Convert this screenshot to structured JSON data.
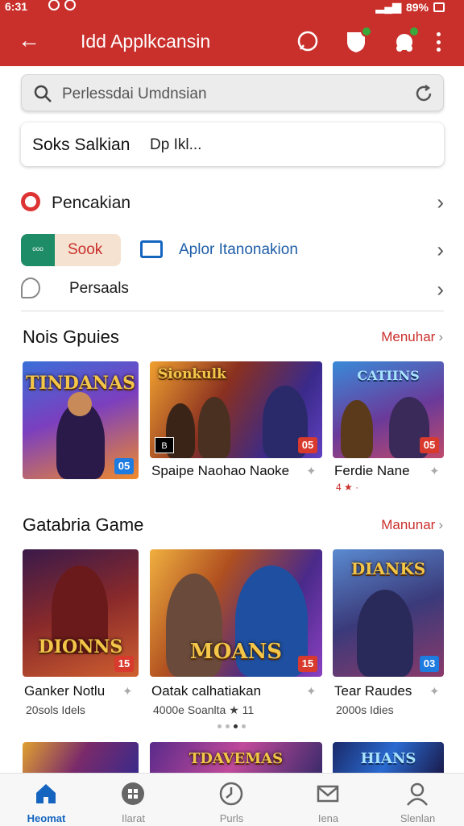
{
  "status_bar": {
    "time": "6:31",
    "battery": "89%"
  },
  "app_bar": {
    "title": "Idd Applkcansin"
  },
  "search": {
    "placeholder": "Perlessdai Umdnsian"
  },
  "filter": {
    "label": "Soks Salkian",
    "value": "Dp Ikl..."
  },
  "menu": {
    "pencakian": "Pencakian",
    "sook_chip_icon": "ᵒᵒᵒ",
    "sook_chip_label": "Sook",
    "apl_label": "Aplor Itanonakion",
    "persaals": "Persaals"
  },
  "section1": {
    "title": "Nois Gpuies",
    "more": "Menuhar",
    "cards": [
      {
        "logo": "TINDANAS",
        "age": "05",
        "age_color": "#1e7be0"
      },
      {
        "logo": "Sionkulk",
        "age": "05",
        "name": "Spaipe Naohao Naoke",
        "age_color": "#d83a2e",
        "box": "B"
      },
      {
        "logo": "CATIINS",
        "age": "05",
        "name": "Ferdie Nane",
        "meta": "4 ★ ·",
        "age_color": "#d83a2e"
      }
    ]
  },
  "section2": {
    "title": "Gatabria Game",
    "more": "Manunar",
    "cards": [
      {
        "logo": "DIONNS",
        "age": "15",
        "name": "Ganker Notlu",
        "meta": "20sols Idels",
        "age_color": "#d83a2e"
      },
      {
        "logo": "MOANS",
        "age": "15",
        "name": "Oatak calhatiakan",
        "meta": "4000e   Soanlta  ★ 11",
        "age_color": "#d83a2e"
      },
      {
        "logo": "DIANKS",
        "age": "03",
        "name": "Tear Raudes",
        "meta": "2000s Idies",
        "age_color": "#1e7be0"
      }
    ]
  },
  "section3": {
    "cards": [
      {
        "logo": ""
      },
      {
        "logo": "TDAVEMAS"
      },
      {
        "logo": "HIANS"
      }
    ]
  },
  "bottom_nav": [
    {
      "label": "Heomat"
    },
    {
      "label": "Ilarat"
    },
    {
      "label": "Purls"
    },
    {
      "label": "Iena"
    },
    {
      "label": "Slenlan"
    }
  ],
  "colors": {
    "primary": "#c9302c",
    "link": "#1f5fa8",
    "active_nav": "#1565c0"
  }
}
